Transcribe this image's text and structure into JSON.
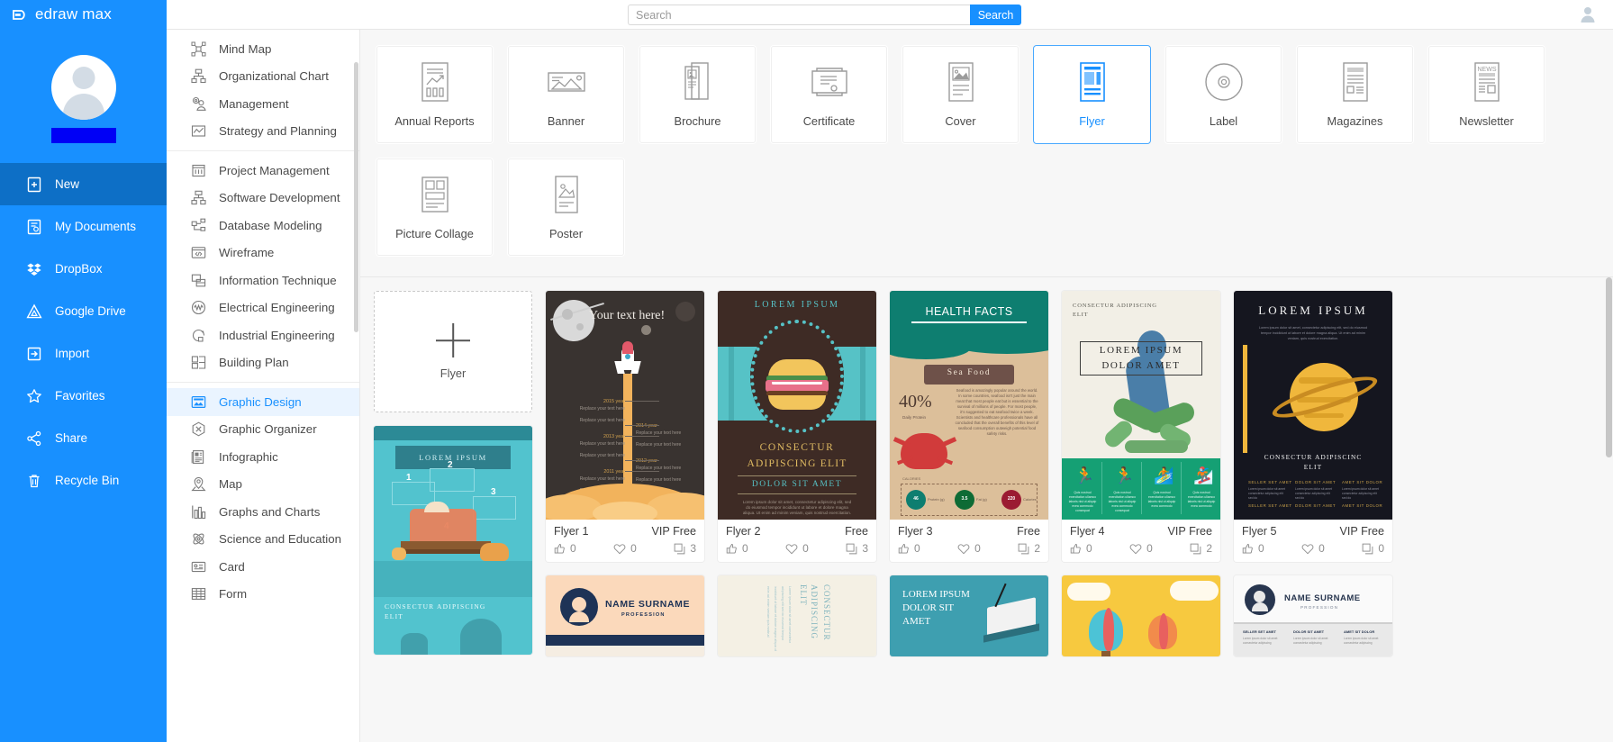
{
  "app": {
    "brand": "edraw max"
  },
  "search": {
    "placeholder": "Search",
    "value": "",
    "button_label": "Search"
  },
  "sidebar": {
    "items": [
      {
        "label": "New",
        "icon": "new-document-icon",
        "active": true
      },
      {
        "label": "My Documents",
        "icon": "documents-icon",
        "active": false
      },
      {
        "label": "DropBox",
        "icon": "dropbox-icon",
        "active": false
      },
      {
        "label": "Google Drive",
        "icon": "google-drive-icon",
        "active": false
      },
      {
        "label": "Import",
        "icon": "import-icon",
        "active": false
      },
      {
        "label": "Favorites",
        "icon": "star-icon",
        "active": false
      },
      {
        "label": "Share",
        "icon": "share-icon",
        "active": false
      },
      {
        "label": "Recycle Bin",
        "icon": "trash-icon",
        "active": false
      }
    ]
  },
  "categories": {
    "groups": [
      {
        "items": [
          {
            "label": "Mind Map",
            "icon": "mind-map-icon"
          },
          {
            "label": "Organizational Chart",
            "icon": "org-chart-icon"
          },
          {
            "label": "Management",
            "icon": "management-icon"
          },
          {
            "label": "Strategy and Planning",
            "icon": "strategy-icon"
          }
        ]
      },
      {
        "items": [
          {
            "label": "Project Management",
            "icon": "project-management-icon"
          },
          {
            "label": "Software Development",
            "icon": "software-development-icon"
          },
          {
            "label": "Database Modeling",
            "icon": "database-modeling-icon"
          },
          {
            "label": "Wireframe",
            "icon": "wireframe-icon"
          },
          {
            "label": "Information Technique",
            "icon": "information-technique-icon"
          },
          {
            "label": "Electrical Engineering",
            "icon": "electrical-engineering-icon"
          },
          {
            "label": "Industrial Engineering",
            "icon": "industrial-engineering-icon"
          },
          {
            "label": "Building Plan",
            "icon": "building-plan-icon"
          }
        ]
      },
      {
        "items": [
          {
            "label": "Graphic Design",
            "icon": "graphic-design-icon",
            "active": true
          },
          {
            "label": "Graphic Organizer",
            "icon": "graphic-organizer-icon"
          },
          {
            "label": "Infographic",
            "icon": "infographic-icon"
          },
          {
            "label": "Map",
            "icon": "map-pin-icon"
          },
          {
            "label": "Graphs and Charts",
            "icon": "bar-chart-icon"
          },
          {
            "label": "Science and Education",
            "icon": "atom-icon"
          },
          {
            "label": "Card",
            "icon": "id-card-icon"
          },
          {
            "label": "Form",
            "icon": "table-grid-icon"
          }
        ]
      }
    ]
  },
  "types": [
    {
      "label": "Annual Reports",
      "icon": "annual-report-icon",
      "selected": false
    },
    {
      "label": "Banner",
      "icon": "banner-icon",
      "selected": false
    },
    {
      "label": "Brochure",
      "icon": "brochure-icon",
      "selected": false
    },
    {
      "label": "Certificate",
      "icon": "certificate-icon",
      "selected": false
    },
    {
      "label": "Cover",
      "icon": "cover-icon",
      "selected": false
    },
    {
      "label": "Flyer",
      "icon": "flyer-icon",
      "selected": true
    },
    {
      "label": "Label",
      "icon": "label-disc-icon",
      "selected": false
    },
    {
      "label": "Magazines",
      "icon": "magazine-icon",
      "selected": false
    },
    {
      "label": "Newsletter",
      "icon": "newsletter-icon",
      "selected": false
    },
    {
      "label": "Picture Collage",
      "icon": "collage-icon",
      "selected": false
    },
    {
      "label": "Poster",
      "icon": "poster-icon",
      "selected": false
    }
  ],
  "templates": {
    "new_card": {
      "label": "Flyer",
      "icon": "plus-icon"
    },
    "items": [
      {
        "title": "Flyer 1",
        "price": "VIP Free",
        "likes": "0",
        "favorites": "0",
        "copies": "3",
        "art": "rocket",
        "texts": {
          "headline": "Your text here!"
        }
      },
      {
        "title": "Flyer 2",
        "price": "Free",
        "likes": "0",
        "favorites": "0",
        "copies": "3",
        "art": "burger",
        "texts": {
          "top": "LOREM IPSUM",
          "l1": "CONSECTUR",
          "l2": "ADIPISCING ELIT",
          "l3": "DOLOR SIT AMET"
        }
      },
      {
        "title": "Flyer 3",
        "price": "Free",
        "likes": "0",
        "favorites": "0",
        "copies": "2",
        "art": "seafood",
        "texts": {
          "top": "HEALTH FACTS",
          "badge": "Sea Food",
          "pct": "40%",
          "b1": "3.5",
          "b2": "220"
        }
      },
      {
        "title": "Flyer 4",
        "price": "VIP Free",
        "likes": "0",
        "favorites": "0",
        "copies": "2",
        "art": "runner",
        "texts": {
          "top": "CONSECTUR ADIPISCING ELIT",
          "l1": "LOREM IPSUM",
          "l2": "DOLOR AMET"
        }
      },
      {
        "title": "Flyer 5",
        "price": "VIP Free",
        "likes": "0",
        "favorites": "0",
        "copies": "0",
        "art": "planet",
        "texts": {
          "top": "LOREM  IPSUM",
          "l1": "CONSECTUR ADIPISCINC",
          "l2": "ELIT"
        }
      }
    ],
    "row2": [
      {
        "art": "bench",
        "texts": {
          "ribbon": "LOREM IPSUM",
          "foot1": "CONSECTUR ADIPISCING",
          "foot2": "ELIT"
        }
      },
      {
        "art": "namecard",
        "texts": {
          "name": "NAME SURNAME",
          "role": "PROFESSION"
        }
      },
      {
        "art": "vertical",
        "texts": {
          "l1": "CONSECTUR",
          "l2": "ADIPISCING",
          "l3": "ELIT"
        }
      },
      {
        "art": "teal",
        "texts": {
          "l1": "LOREM IPSUM",
          "l2": "DOLOR SIT",
          "l3": "AMET"
        }
      },
      {
        "art": "balloon",
        "texts": {}
      },
      {
        "art": "resume",
        "texts": {
          "name": "NAME SURNAME",
          "role": "PROFESSION"
        }
      }
    ]
  },
  "colors": {
    "brand_blue": "#1890ff",
    "sidebar_active": "#0d6fc6",
    "accent_selected": "#49a9ff",
    "page_bg": "#f7f7f7"
  }
}
